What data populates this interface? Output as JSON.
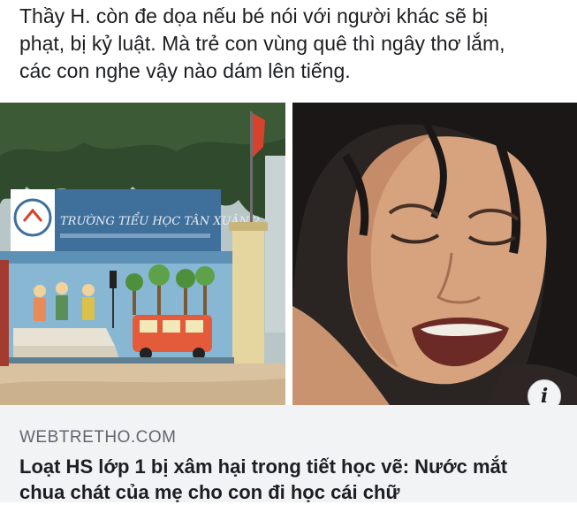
{
  "post": {
    "lines": [
      "Thầy H. còn đe dọa nếu bé nói với người khác sẽ bị",
      "phạt, bị kỷ luật. Mà trẻ con vùng quê thì ngây thơ lắm,",
      "các con nghe vậy nào dám lên tiếng."
    ]
  },
  "images": {
    "school_sign": "TRƯỜNG TIỂU HỌC TÂN XUÂN 2",
    "left_icon": "school-photo",
    "right_icon": "crying-mother-photo"
  },
  "info_button": {
    "label": "i",
    "icon": "info-icon"
  },
  "link_card": {
    "domain": "WEBTRETHO.COM",
    "title_lines": [
      "Loạt HS lớp 1 bị xâm hại trong tiết học vẽ: Nước mắt",
      "chua chát của mẹ cho con đi học cái chữ"
    ]
  },
  "colors": {
    "text": "#1c1e21",
    "muted": "#606770",
    "card_bg": "#f2f3f5"
  }
}
